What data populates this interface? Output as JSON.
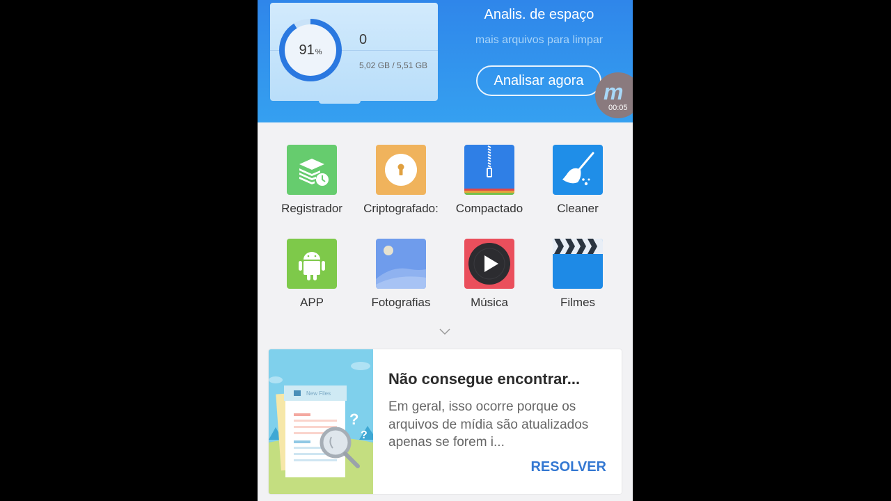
{
  "storage": {
    "percent_used": 91,
    "percent_label": "91",
    "percent_unit": "%",
    "count": "0",
    "usage": "5,02 GB / 5,51 GB"
  },
  "analysis": {
    "title": "Analis. de espaço",
    "subtitle": "mais arquivos para limpar",
    "button_label": "Analisar agora"
  },
  "recorder": {
    "logo": "m",
    "elapsed": "00:05"
  },
  "categories": [
    {
      "label": "Registrador",
      "icon": "layers-clock-icon",
      "color": "#66cc6e"
    },
    {
      "label": "Criptografado:",
      "icon": "keyhole-lock-icon",
      "color": "#f0b35c"
    },
    {
      "label": "Compactado",
      "icon": "zip-icon",
      "color": "#2f7fe6"
    },
    {
      "label": "Cleaner",
      "icon": "broom-icon",
      "color": "#1f8ee8"
    },
    {
      "label": "APP",
      "icon": "android-icon",
      "color": "#7ec94a"
    },
    {
      "label": "Fotografias",
      "icon": "photo-icon",
      "color": "#6f9cec"
    },
    {
      "label": "Música",
      "icon": "play-disc-icon",
      "color": "#ea4f5c"
    },
    {
      "label": "Filmes",
      "icon": "clapperboard-icon",
      "color": "#1e8ae6"
    }
  ],
  "tip_card": {
    "illustration_label": "New Files",
    "title": "Não consegue encontrar...",
    "body": "Em geral, isso ocorre porque os arquivos de mídia são atualizados apenas se forem i...",
    "action_label": "RESOLVER"
  }
}
